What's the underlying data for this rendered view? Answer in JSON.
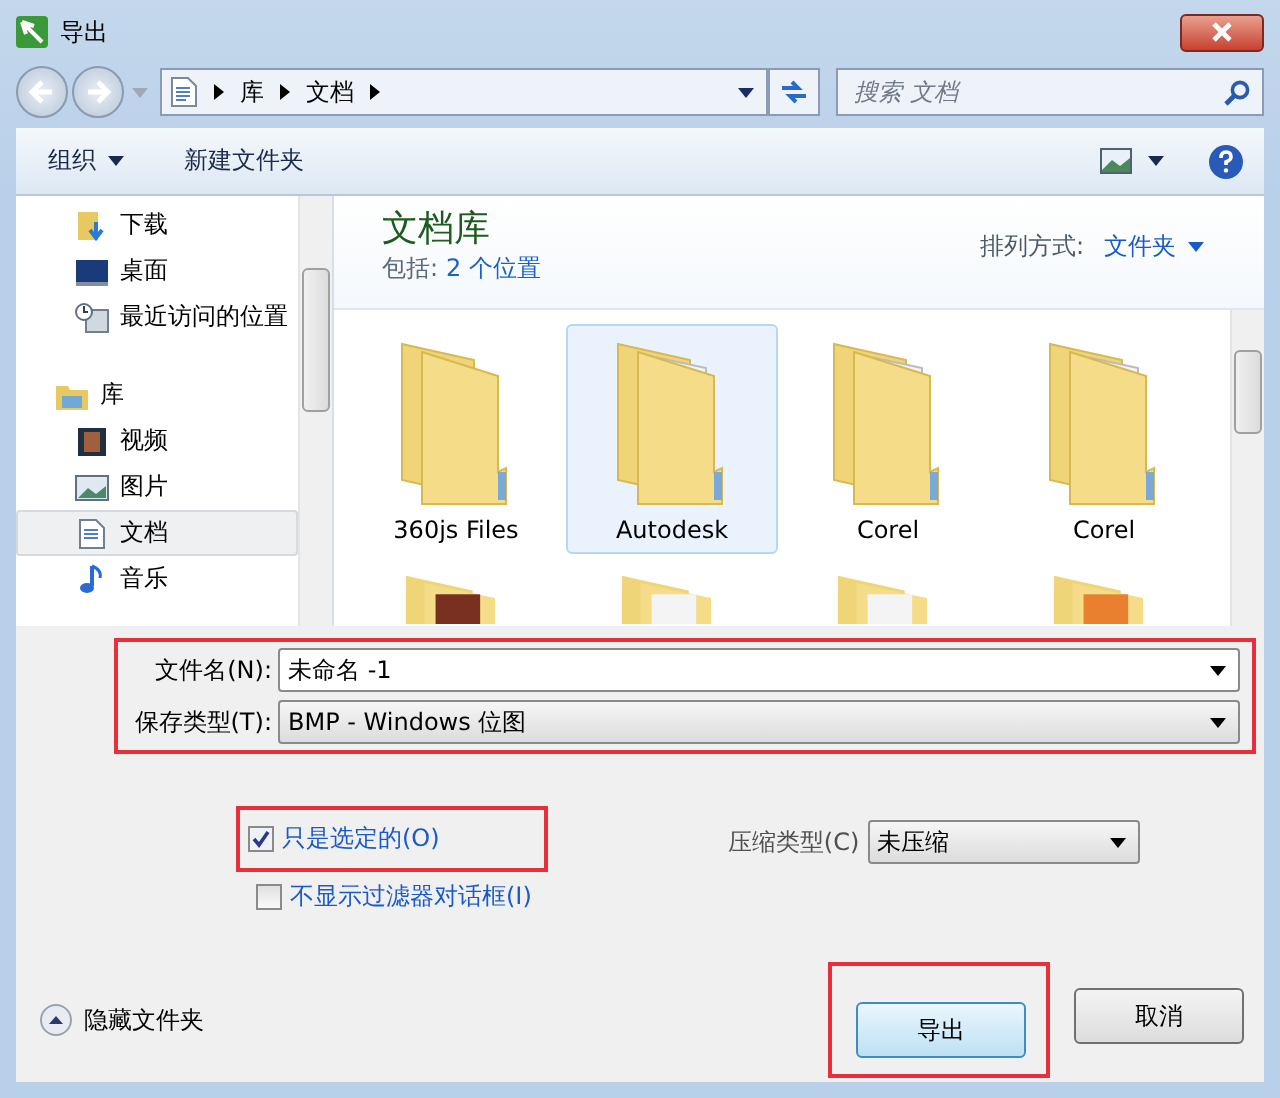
{
  "window": {
    "title": "导出"
  },
  "address": {
    "crumbs": [
      "库",
      "文档"
    ],
    "search_placeholder": "搜索 文档"
  },
  "toolbar": {
    "organize": "组织",
    "new_folder": "新建文件夹"
  },
  "nav": {
    "favorites": [
      {
        "label": "下载",
        "kind": "download",
        "selected": false
      },
      {
        "label": "桌面",
        "kind": "desktop",
        "selected": false
      },
      {
        "label": "最近访问的位置",
        "kind": "recent",
        "selected": false
      }
    ],
    "library": {
      "label": "库",
      "children": [
        {
          "label": "视频",
          "kind": "video",
          "selected": false
        },
        {
          "label": "图片",
          "kind": "pictures",
          "selected": false
        },
        {
          "label": "文档",
          "kind": "documents",
          "selected": true
        },
        {
          "label": "音乐",
          "kind": "music",
          "selected": false
        }
      ]
    }
  },
  "content": {
    "title": "文档库",
    "includes_label": "包括:",
    "includes_link": "2 个位置",
    "arrange_label": "排列方式:",
    "arrange_value": "文件夹",
    "folders": [
      {
        "name": "360js Files",
        "kind": "plain",
        "selected": false
      },
      {
        "name": "Autodesk",
        "kind": "papers",
        "selected": true
      },
      {
        "name": "Corel",
        "kind": "papers",
        "selected": false
      },
      {
        "name": "Corel",
        "kind": "papers",
        "selected": false
      }
    ]
  },
  "form": {
    "filename_label": "文件名(N):",
    "filename_value": "未命名 -1",
    "type_label": "保存类型(T):",
    "type_value": "BMP - Windows 位图",
    "options": [
      {
        "label": "只是选定的(O)",
        "checked": true
      },
      {
        "label": "不显示过滤器对话框(I)",
        "checked": false
      }
    ],
    "compression_label": "压缩类型(C)",
    "compression_value": "未压缩"
  },
  "footer": {
    "hide_folders": "隐藏文件夹",
    "buttons": [
      {
        "label": "导出",
        "default": true
      },
      {
        "label": "取消",
        "default": false
      }
    ]
  }
}
